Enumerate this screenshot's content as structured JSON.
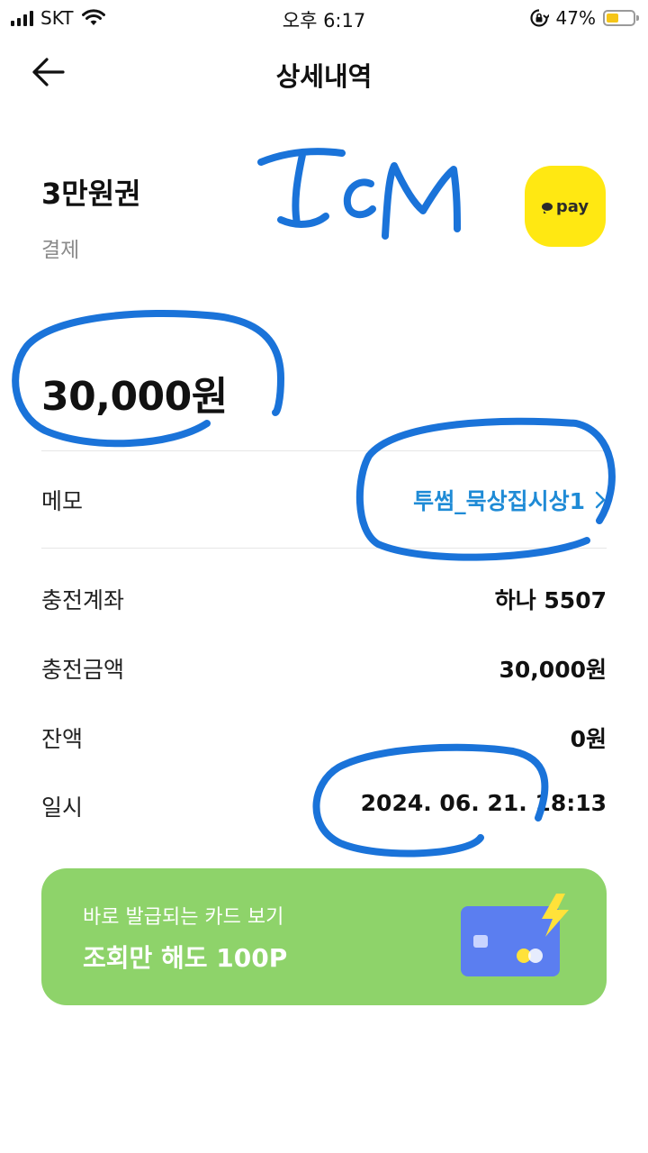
{
  "status_bar": {
    "carrier": "SKT",
    "time": "오후 6:17",
    "battery_percent": "47%",
    "battery_level": 0.47,
    "battery_color": "#f5c518",
    "icons": [
      "signal-icon",
      "wifi-icon",
      "rotation-lock-icon",
      "battery-icon"
    ]
  },
  "header": {
    "title": "상세내역",
    "back_icon": "arrow-left-icon"
  },
  "product": {
    "title": "3만원권",
    "type": "결제",
    "badge_text": "pay",
    "badge_color": "#ffe812"
  },
  "amount": "30,000원",
  "details": {
    "memo": {
      "label": "메모",
      "value": "투썸_묵상집시상1"
    },
    "rows": [
      {
        "label": "충전계좌",
        "value": "하나 5507"
      },
      {
        "label": "충전금액",
        "value": "30,000원"
      },
      {
        "label": "잔액",
        "value": "0원"
      },
      {
        "label": "일시",
        "value": "2024. 06. 21. 18:13"
      }
    ]
  },
  "banner": {
    "subtitle": "바로 발급되는 카드 보기",
    "title": "조회만 해도 100P",
    "color": "#8ed36a"
  },
  "colors": {
    "accent_link": "#1f8bd6",
    "annotation": "#1a73d9"
  }
}
